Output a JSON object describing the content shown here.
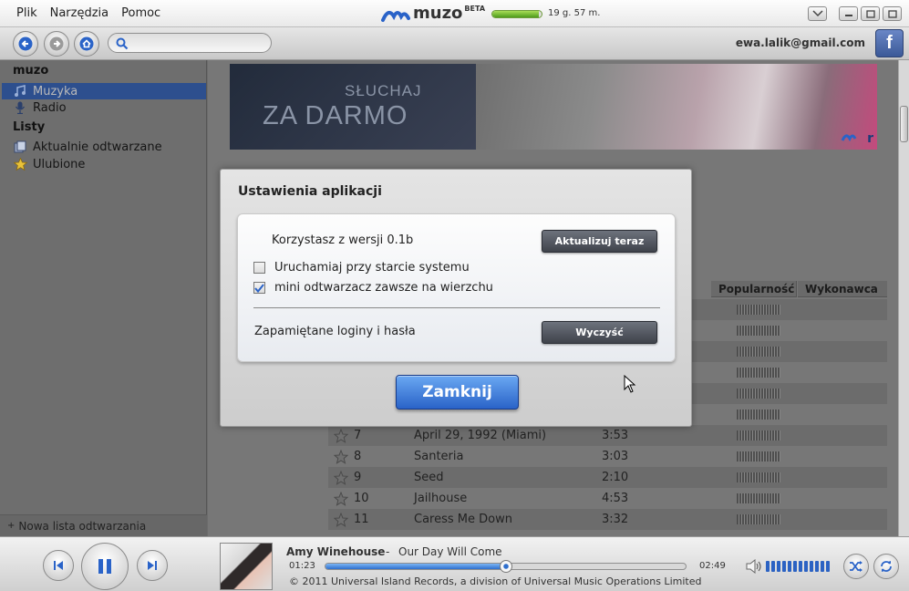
{
  "menu": [
    "Plik",
    "Narzędzia",
    "Pomoc"
  ],
  "brand": {
    "name": "muzo",
    "beta": "BETA"
  },
  "quota": {
    "text": "19 g. 57 m.",
    "fill_fraction": 0.95
  },
  "header": {
    "user_email": "ewa.lalik@gmail.com",
    "search_value": "",
    "facebook_label": "f"
  },
  "sidebar": {
    "section1": "muzo",
    "items1": [
      {
        "label": "Muzyka",
        "icon": "music-note-icon",
        "active": true
      },
      {
        "label": "Radio",
        "icon": "microphone-icon",
        "active": false
      }
    ],
    "section2": "Listy",
    "items2": [
      {
        "label": "Aktualnie odtwarzane",
        "icon": "now-playing-icon"
      },
      {
        "label": "Ulubione",
        "icon": "star-icon"
      }
    ],
    "new_playlist": "Nowa lista odtwarzania",
    "new_playlist_prefix": "+"
  },
  "banner": {
    "line1": "SŁUCHAJ",
    "line2": "ZA DARMO",
    "logo": "r"
  },
  "table": {
    "headers": {
      "popularity": "Popularność",
      "artist": "Wykonawca"
    },
    "rows": [
      {
        "num": "7",
        "title": "April 29, 1992 (Miami)",
        "duration": "3:53"
      },
      {
        "num": "8",
        "title": "Santeria",
        "duration": "3:03"
      },
      {
        "num": "9",
        "title": "Seed",
        "duration": "2:10"
      },
      {
        "num": "10",
        "title": "Jailhouse",
        "duration": "4:53"
      },
      {
        "num": "11",
        "title": "Caress Me Down",
        "duration": "3:32"
      }
    ]
  },
  "dialog": {
    "title": "Ustawienia aplikacji",
    "version_text": "Korzystasz z wersji 0.1b",
    "update_button": "Aktualizuj teraz",
    "checkbox_startup": {
      "label": "Uruchamiaj przy starcie systemu",
      "checked": false
    },
    "checkbox_ontop": {
      "label": "mini odtwarzacz zawsze na wierzchu",
      "checked": true
    },
    "saved_logins": "Zapamiętane loginy i hasła",
    "clear_button": "Wyczyść",
    "close_button": "Zamknij"
  },
  "player": {
    "artist": "Amy Winehouse",
    "separator": "-",
    "title": "Our Day Will Come",
    "elapsed": "01:23",
    "total": "02:49",
    "progress_fraction": 0.5,
    "copyright": "© 2011 Universal Island Records, a division of Universal Music Operations Limited",
    "volume_fraction": 1.0
  },
  "colors": {
    "accent": "#2a63c8",
    "active_sidebar": "#2d4f8e",
    "facebook": "#3b5998"
  }
}
